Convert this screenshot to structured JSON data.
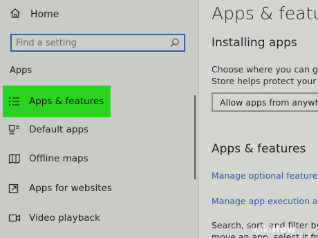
{
  "sidebar": {
    "home_label": "Home",
    "search_placeholder": "Find a setting",
    "section_label": "Apps",
    "items": [
      {
        "label": "Apps & features",
        "icon": "list-icon",
        "active": true
      },
      {
        "label": "Default apps",
        "icon": "default-apps-icon"
      },
      {
        "label": "Offline maps",
        "icon": "map-icon"
      },
      {
        "label": "Apps for websites",
        "icon": "open-external-icon"
      },
      {
        "label": "Video playback",
        "icon": "video-icon"
      }
    ],
    "highlight_color": "#2ad31f"
  },
  "main": {
    "title": "Apps & feature",
    "installing_heading": "Installing apps",
    "installing_text_1": "Choose where you can get",
    "installing_text_2": "Store helps protect your P",
    "dropdown_value": "Allow apps from anywhe",
    "features_heading": "Apps & features",
    "link_optional": "Manage optional features",
    "link_alias": "Manage app execution alia",
    "text_search": "Search, sort, and filter by",
    "text_move": "move an app, select it fro"
  },
  "watermark": {
    "part1": "wiki",
    "part2": "How"
  },
  "colors": {
    "accent": "#2f5fa4",
    "link": "#2a5aa8"
  }
}
